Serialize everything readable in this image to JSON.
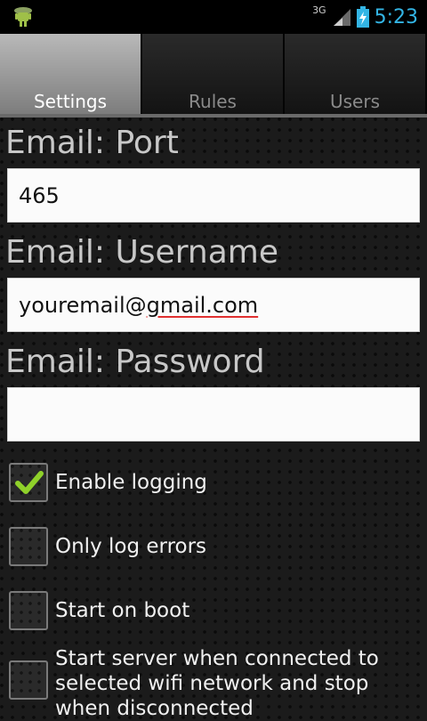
{
  "status_bar": {
    "network_label": "3G",
    "time": "5:23",
    "accent_color": "#33b5e5"
  },
  "tabs": [
    {
      "label": "Settings",
      "active": true
    },
    {
      "label": "Rules",
      "active": false
    },
    {
      "label": "Users",
      "active": false
    }
  ],
  "fields": {
    "port": {
      "label": "Email: Port",
      "value": "465"
    },
    "username": {
      "label": "Email: Username",
      "value_prefix": "youremail@",
      "value_misspelled": "gmail.com"
    },
    "password": {
      "label": "Email: Password",
      "value": ""
    }
  },
  "checkboxes": [
    {
      "label": "Enable logging",
      "checked": true
    },
    {
      "label": "Only log errors",
      "checked": false
    },
    {
      "label": "Start on boot",
      "checked": false
    },
    {
      "label": "Start server when connected to selected wifi network and stop when disconnected",
      "checked": false
    }
  ],
  "icons": {
    "notification": "android-robot-icon",
    "signal": "cell-signal-icon",
    "battery": "battery-charging-icon",
    "check": "checkmark-icon"
  }
}
